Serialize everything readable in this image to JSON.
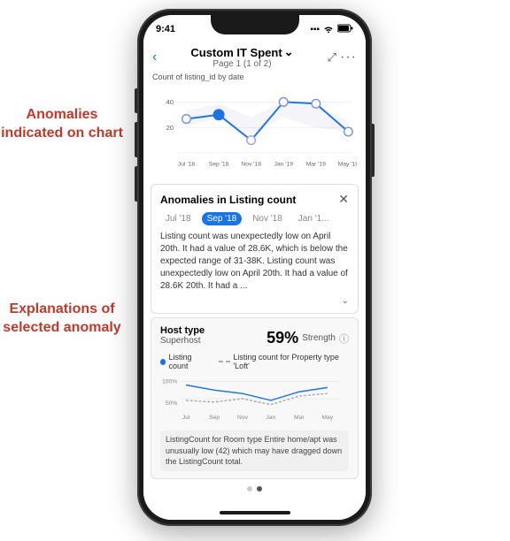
{
  "annotations": {
    "anomalies_label": "Anomalies indicated on chart",
    "explanations_label": "Explanations of selected anomaly"
  },
  "status_bar": {
    "time": "9:41",
    "signal": "●●●",
    "wifi": "wifi",
    "battery": "battery"
  },
  "nav": {
    "back_icon": "‹",
    "title": "Custom IT Spent",
    "dropdown_icon": "⌄",
    "subtitle": "Page 1 (1 of 2)",
    "expand_icon": "⤢",
    "more_icon": "···"
  },
  "chart": {
    "label": "Count of listing_id by date",
    "y_max": "40",
    "y_mid": "20",
    "x_labels": [
      "Jul '18",
      "Sep '18",
      "Nov '18",
      "Jan '19",
      "Mar '19",
      "May '19"
    ]
  },
  "anomaly_panel": {
    "title": "Anomalies in Listing count",
    "tabs": [
      {
        "label": "Jul '18",
        "active": false
      },
      {
        "label": "Sep '18",
        "active": true
      },
      {
        "label": "Nov '18",
        "active": false
      },
      {
        "label": "Jan '1...",
        "active": false
      }
    ],
    "text": "Listing count was unexpectedly low on April 20th. It had a value of 28.6K, which is below the expected range of 31-38K. Listing count was unexpectedly low on April 20th. It had a value of 28.6K 20th. It had a ...",
    "more_icon": "⌄"
  },
  "host_panel": {
    "title": "Host type",
    "subtitle": "Superhost",
    "strength_pct": "59%",
    "strength_label": "Strength",
    "legend": [
      {
        "label": "Listing count",
        "type": "solid",
        "color": "#1a73e8"
      },
      {
        "label": "Listing count for Property type 'Loft'",
        "type": "dashed",
        "color": "#aaa"
      }
    ],
    "y_labels": [
      "100%",
      "50%"
    ],
    "x_labels": [
      "Jul",
      "Sep",
      "Nov",
      "Jan",
      "Mar",
      "May"
    ],
    "caption": "ListingCount for Room type Entire home/apt was unusually low (42) which may have dragged down the ListingCount total."
  },
  "page_dots": [
    {
      "active": false
    },
    {
      "active": true
    }
  ]
}
